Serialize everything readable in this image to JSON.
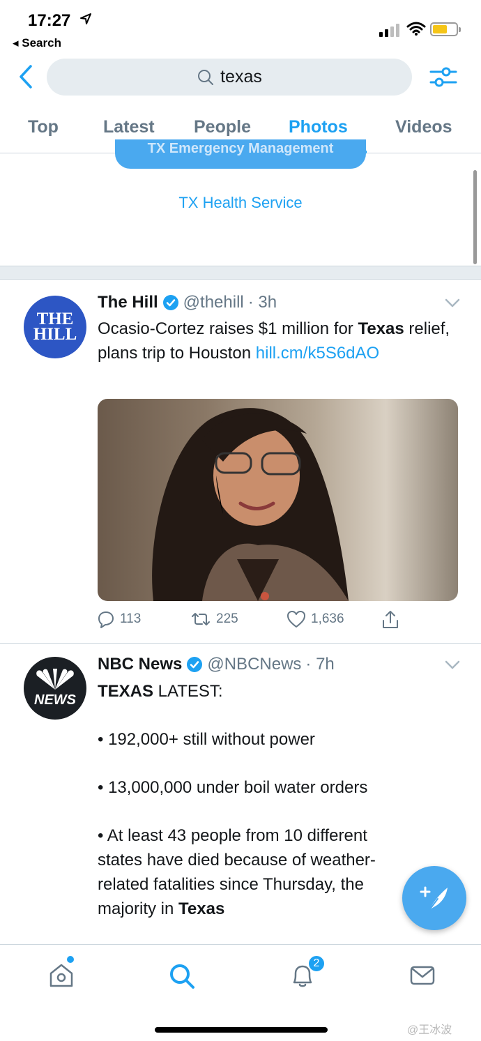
{
  "status_bar": {
    "time": "17:27",
    "back_app": "◂ Search"
  },
  "search": {
    "query": "texas"
  },
  "tabs": [
    {
      "label": "Top"
    },
    {
      "label": "Latest"
    },
    {
      "label": "People"
    },
    {
      "label": "Photos",
      "active": true
    },
    {
      "label": "Videos"
    }
  ],
  "related": {
    "pill_label": "TX Emergency Management",
    "link_label": "TX Health Service"
  },
  "tweets": [
    {
      "avatar_text": "THE HILL",
      "name": "The Hill",
      "handle": "@thehill",
      "time": "· 3h",
      "text_pre": "Ocasio-Cortez raises $1 million for ",
      "text_bold": "Texas",
      "text_post": " relief, plans trip to Houston ",
      "link": "hill.cm/k5S6dAO",
      "replies": "113",
      "retweets": "225",
      "likes": "1,636"
    },
    {
      "avatar_text": "NEWS",
      "name": "NBC News",
      "handle": "@NBCNews",
      "time": "· 7h",
      "headline_bold": "TEXAS",
      "headline_rest": " LATEST:",
      "bullet1": "• 192,000+ still without power",
      "bullet2": "• 13,000,000 under boil water orders",
      "bullet3_pre": "• At least 43 people from 10 different states have died because of weather-related fatalities since Thursday, the majority in ",
      "bullet3_bold": "Texas"
    }
  ],
  "bottom_nav": {
    "notifications_badge": "2"
  },
  "watermark": "@王冰波",
  "colors": {
    "accent": "#1da1f2",
    "muted": "#657786"
  }
}
